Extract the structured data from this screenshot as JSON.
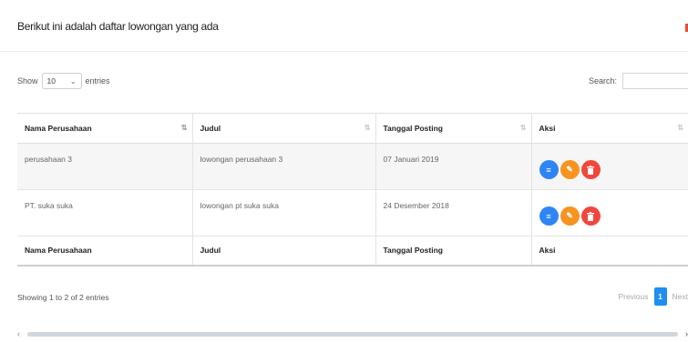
{
  "page": {
    "title": "Berikut ini adalah daftar lowongan yang ada"
  },
  "length_menu": {
    "show_label": "Show",
    "selected": "10",
    "entries_label": "entries"
  },
  "search": {
    "label": "Search:",
    "value": ""
  },
  "table": {
    "headers": [
      "Nama Perusahaan",
      "Judul",
      "Tanggal Posting",
      "Aksi"
    ],
    "footers": [
      "Nama Perusahaan",
      "Judul",
      "Tanggal Posting",
      "Aksi"
    ],
    "rows": [
      {
        "nama": "perusahaan 3",
        "judul": "lowongan perusahaan 3",
        "tanggal": "07 Januari 2019"
      },
      {
        "nama": "PT. suka suka",
        "judul": "lowongan pt suka suka",
        "tanggal": "24 Desember 2018"
      }
    ],
    "action_icons": {
      "view": "list-icon",
      "edit": "pencil-icon",
      "delete": "trash-icon"
    }
  },
  "info": "Showing 1 to 2 of 2 entries",
  "pagination": {
    "previous": "Previous",
    "current": "1",
    "next": "Next"
  },
  "colors": {
    "view": "#2e86f5",
    "edit": "#f7931e",
    "delete": "#f2463c",
    "active_page": "#1f8ef0"
  }
}
